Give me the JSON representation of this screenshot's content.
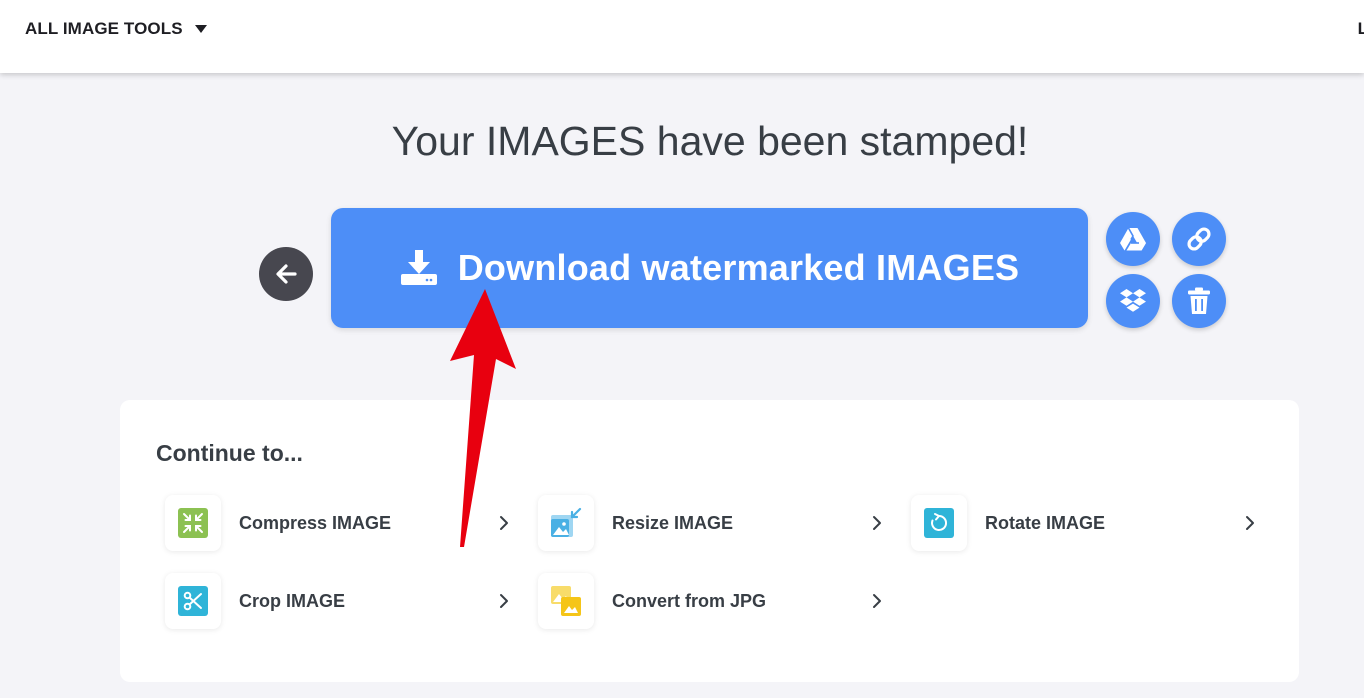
{
  "header": {
    "tools_menu_label": "ALL IMAGE TOOLS",
    "edge_text": "L"
  },
  "main": {
    "title": "Your IMAGES have been stamped!",
    "download_label": "Download watermarked IMAGES"
  },
  "actions": {
    "icons": [
      "arrow-left-icon",
      "google-drive-icon",
      "link-icon",
      "dropbox-icon",
      "trash-icon"
    ]
  },
  "continue_card": {
    "title": "Continue to...",
    "tools": [
      {
        "label": "Compress IMAGE",
        "icon": "compress-icon",
        "color": "#8cc152"
      },
      {
        "label": "Resize IMAGE",
        "icon": "resize-icon",
        "color": "#4ab0e4"
      },
      {
        "label": "Rotate IMAGE",
        "icon": "rotate-icon",
        "color": "#2fb4d8"
      },
      {
        "label": "Crop IMAGE",
        "icon": "crop-icon",
        "color": "#2fb4d8"
      },
      {
        "label": "Convert from JPG",
        "icon": "convert-icon",
        "color": "#f5c518"
      }
    ]
  },
  "colors": {
    "accent": "#4d8ef7",
    "background": "#f4f4f8",
    "back_button": "#47474f",
    "annotation_arrow": "#e8000f"
  }
}
